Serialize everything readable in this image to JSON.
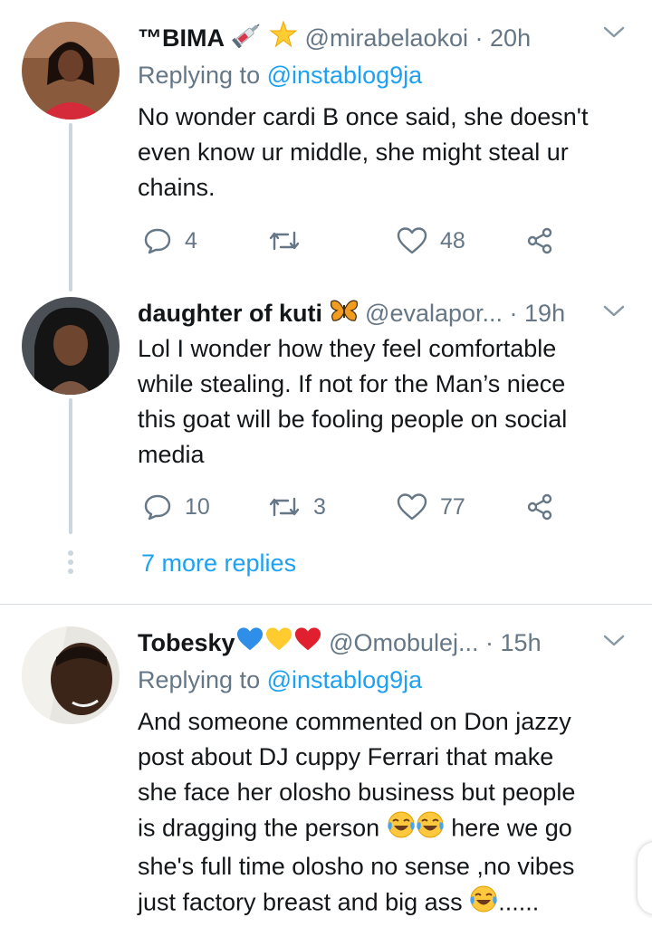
{
  "tweets": [
    {
      "name": "™BIMA",
      "name_emojis": [
        "syringe-emoji",
        "star-emoji"
      ],
      "handle": "@mirabelaokoi",
      "time": "· 20h",
      "replying_prefix": "Replying to",
      "replying_user": "@instablog9ja",
      "lines": [
        "No wonder cardi B once said, she doesn't",
        "even know ur middle, she might steal ur",
        "chains."
      ],
      "replies": "4",
      "retweets": "",
      "likes": "48"
    },
    {
      "name": "daughter of kuti",
      "name_emojis": [
        "butterfly-emoji"
      ],
      "handle": "@evalapor...",
      "time": "· 19h",
      "lines": [
        "Lol I wonder how they feel comfortable",
        "while stealing. If not for the Man’s   niece",
        "this goat will be fooling people on social",
        "media"
      ],
      "replies": "10",
      "retweets": "3",
      "likes": "77"
    },
    {
      "name": "Tobesky",
      "name_emojis": [
        "blue-heart-emoji",
        "yellow-heart-emoji",
        "red-heart-emoji"
      ],
      "handle": "@Omobulej...",
      "time": "· 15h",
      "replying_prefix": "Replying to",
      "replying_user": "@instablog9ja",
      "lines": [
        "And someone commented on Don jazzy",
        "post about DJ cuppy Ferrari that make",
        "she face her olosho business but people"
      ],
      "line4_a": "is dragging the person ",
      "line4_b": " here we go",
      "line5": "she's full time olosho no sense ,no vibes",
      "line6_a": "just factory breast and big ass ",
      "line6_b": "......"
    }
  ],
  "more_replies": "7 more replies",
  "colors": {
    "link": "#1da1f2",
    "muted": "#657786",
    "thread": "#ccd6dd"
  }
}
